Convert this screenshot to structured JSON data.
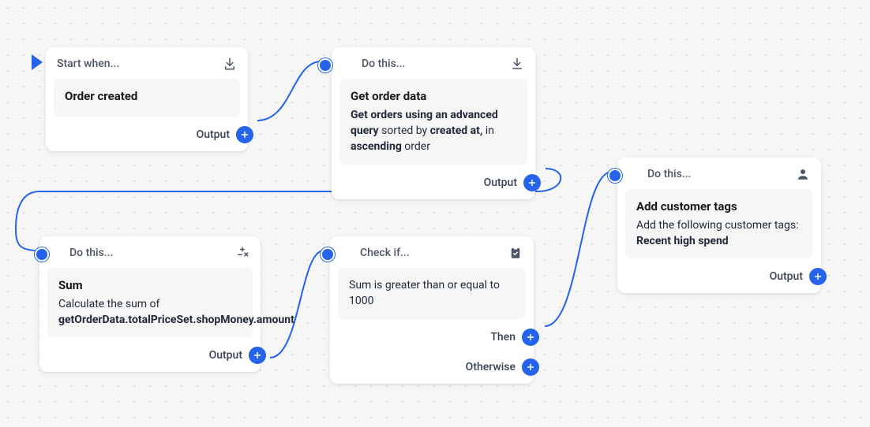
{
  "canvas": {
    "accent": "#2563eb"
  },
  "start": {
    "header": "Start when...",
    "title": "Order created",
    "output_label": "Output"
  },
  "getdata": {
    "header": "Do this...",
    "title": "Get order data",
    "desc_pre_bold": "Get orders using an advanced query",
    "desc_mid1": " sorted by ",
    "desc_bold2": "created at,",
    "desc_mid2": " in ",
    "desc_bold3": "ascending",
    "desc_tail": " order",
    "output_label": "Output"
  },
  "sum": {
    "header": "Do this...",
    "title": "Sum",
    "desc_pre": "Calculate the sum of ",
    "desc_bold": "getOrderData.totalPriceSet.shopMoney.amount",
    "output_label": "Output"
  },
  "check": {
    "header": "Check if...",
    "condition": "Sum is greater than or equal to 1000",
    "then_label": "Then",
    "otherwise_label": "Otherwise"
  },
  "tags": {
    "header": "Do this...",
    "title": "Add customer tags",
    "desc_pre": "Add the following customer tags: ",
    "desc_bold": "Recent high spend",
    "output_label": "Output"
  }
}
